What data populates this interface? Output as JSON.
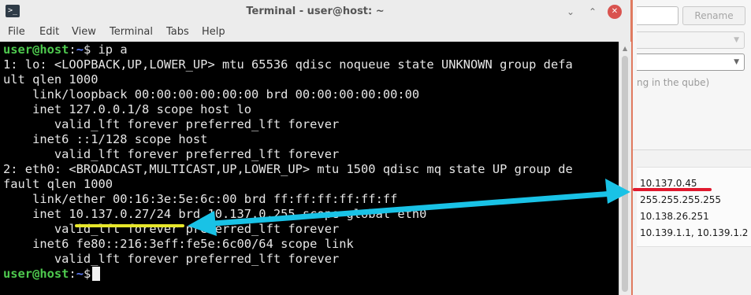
{
  "terminal": {
    "title": "Terminal - user@host: ~",
    "controls": {
      "minimize": "⌄",
      "maximize": "⌃",
      "close": "✕"
    },
    "menu": [
      "File",
      "Edit",
      "View",
      "Terminal",
      "Tabs",
      "Help"
    ],
    "prompt": {
      "user": "user@host",
      "path": "~",
      "sign": "$"
    },
    "command": " ip a",
    "output": [
      "1: lo: <LOOPBACK,UP,LOWER_UP> mtu 65536 qdisc noqueue state UNKNOWN group defa",
      "ult qlen 1000",
      "    link/loopback 00:00:00:00:00:00 brd 00:00:00:00:00:00",
      "    inet 127.0.0.1/8 scope host lo",
      "       valid_lft forever preferred_lft forever",
      "    inet6 ::1/128 scope host",
      "       valid_lft forever preferred_lft forever",
      "2: eth0: <BROADCAST,MULTICAST,UP,LOWER_UP> mtu 1500 qdisc mq state UP group de",
      "fault qlen 1000",
      "    link/ether 00:16:3e:5e:6c:00 brd ff:ff:ff:ff:ff:ff",
      "    inet 10.137.0.27/24 brd 10.137.0.255 scope global eth0",
      "       valid_lft forever preferred_lft forever",
      "    inet6 fe80::216:3eff:fe5e:6c00/64 scope link",
      "       valid_lft forever preferred_lft forever"
    ]
  },
  "settings_window": {
    "rename_label": "Rename",
    "hint": "ng in the qube)",
    "values": [
      "10.137.0.45",
      "255.255.255.255",
      "10.138.26.251",
      "10.139.1.1, 10.139.1.2"
    ]
  },
  "colors": {
    "terminal_bg": "#000000",
    "prompt_user": "#4ec94e",
    "prompt_path": "#5c7cfa",
    "arrow": "#19c2e6",
    "highlight_terminal": "#e6e62a",
    "highlight_settings": "#e0192e"
  },
  "icons": [
    "terminal-app-icon",
    "minimize-icon",
    "maximize-icon",
    "close-icon",
    "chevron-down-icon",
    "double-arrow-icon"
  ]
}
